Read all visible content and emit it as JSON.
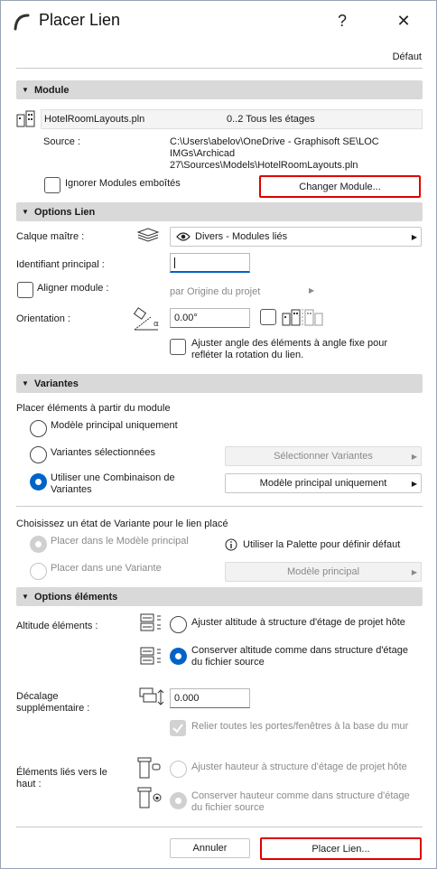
{
  "window": {
    "title": "Placer Lien",
    "help": "?",
    "close": "✕"
  },
  "default_label": "Défaut",
  "module": {
    "header": "Module",
    "file_name": "HotelRoomLayouts.pln",
    "file_levels": "0..2 Tous les étages",
    "source_label": "Source :",
    "source_path_line1": "C:\\Users\\abelov\\OneDrive - Graphisoft SE\\LOC",
    "source_path_line2": "IMGs\\Archicad",
    "source_path_line3": "27\\Sources\\Models\\HotelRoomLayouts.pln",
    "ignore_nested_label": "Ignorer Modules emboîtés",
    "change_module_button": "Changer Module..."
  },
  "link_options": {
    "header": "Options Lien",
    "master_layer_label": "Calque maître :",
    "master_layer_value": "Divers - Modules liés",
    "main_id_label": "Identifiant principal :",
    "main_id_value": "",
    "align_module_label": "Aligner module :",
    "align_module_value": "par Origine du projet",
    "orientation_label": "Orientation :",
    "orientation_value": "0.00°",
    "adjust_angle_label_line1": "Ajuster angle des éléments à angle fixe pour",
    "adjust_angle_label_line2": "refléter la rotation du lien."
  },
  "variants": {
    "header": "Variantes",
    "place_from_label": "Placer éléments à partir du module",
    "option_main_only": "Modèle principal uniquement",
    "option_selected": "Variantes sélectionnées",
    "select_variants_button": "Sélectionner Variantes",
    "option_combination_line1": "Utiliser une Combinaison de",
    "option_combination_line2": "Variantes",
    "combination_value": "Modèle principal uniquement",
    "choose_state_label": "Choisissez un état de Variante pour le lien placé",
    "state_main_model": "Placer dans le Modèle principal",
    "state_variant": "Placer dans une Variante",
    "palette_info": "Utiliser la Palette pour définir défaut",
    "state_variant_value": "Modèle principal"
  },
  "element_options": {
    "header": "Options éléments",
    "altitude_label": "Altitude éléments :",
    "altitude_adjust": "Ajuster altitude à structure d'étage de projet hôte",
    "altitude_keep_line1": "Conserver altitude comme dans structure d'étage",
    "altitude_keep_line2": "du fichier source",
    "offset_label_line1": "Décalage",
    "offset_label_line2": "supplémentaire :",
    "offset_value": "0.000",
    "relink_doors_label": "Relier toutes les portes/fenêtres à la base du mur",
    "linked_top_label_line1": "Éléments liés vers le",
    "linked_top_label_line2": "haut :",
    "height_adjust": "Ajuster hauteur à structure d'étage de projet hôte",
    "height_keep_line1": "Conserver hauteur comme dans structure d'étage",
    "height_keep_line2": "du fichier source"
  },
  "footer": {
    "cancel_button": "Annuler",
    "place_button": "Placer Lien..."
  },
  "colors": {
    "accent": "#0063c8",
    "highlight": "#e00000",
    "section_header": "#d9d9d9"
  },
  "icons": [
    "app-arc-icon",
    "building-levels-icon",
    "layers-icon",
    "eye-icon",
    "orientation-angle-icon",
    "building-pair-icon",
    "info-icon",
    "elevation-icon",
    "offset-icon",
    "wall-link-icon",
    "height-lock-icon"
  ]
}
